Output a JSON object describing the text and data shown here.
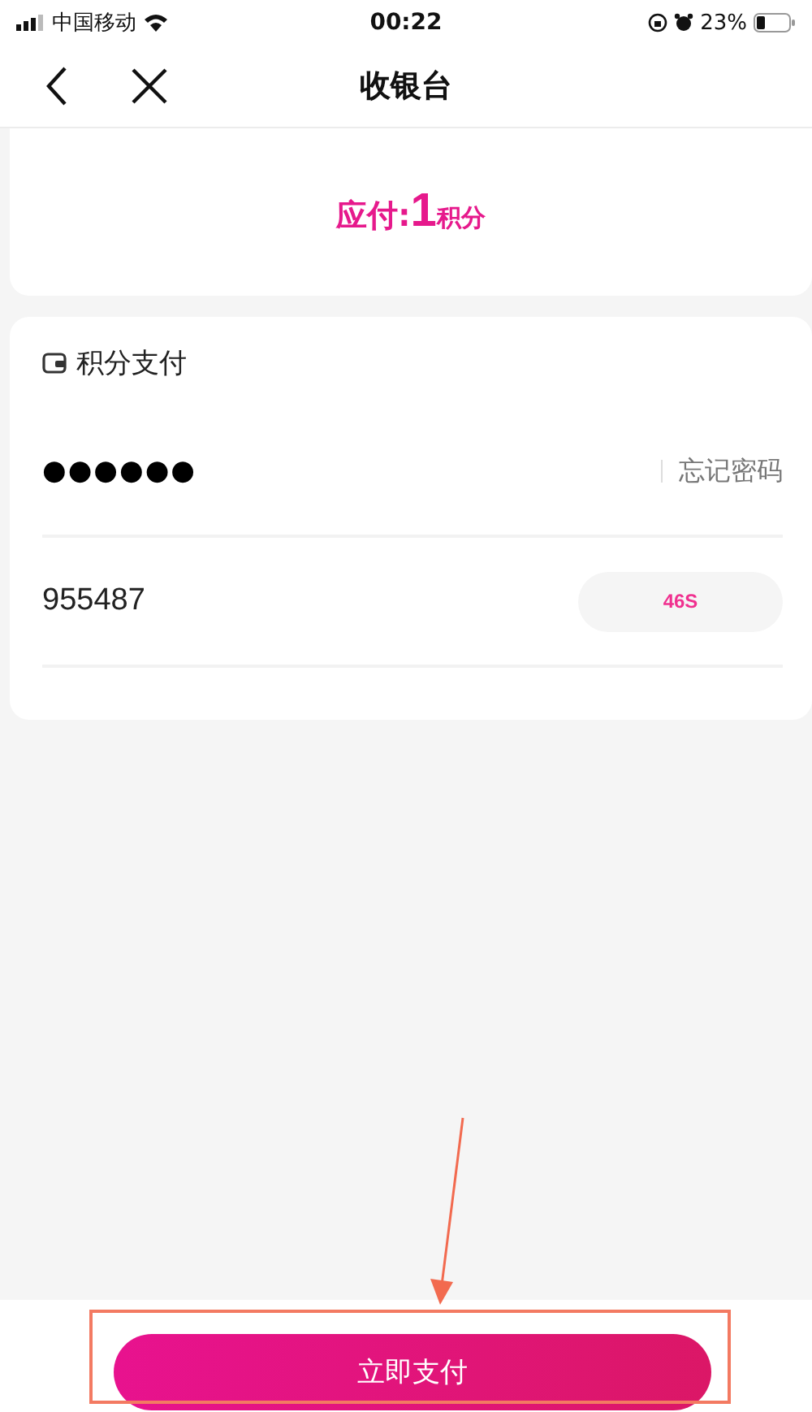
{
  "status_bar": {
    "carrier": "中国移动",
    "time": "00:22",
    "battery": "23%"
  },
  "nav": {
    "title": "收银台"
  },
  "amount": {
    "label": "应付:",
    "value": "1",
    "unit": "积分"
  },
  "payment": {
    "title": "积分支付",
    "password": "●●●●●●",
    "forgot_link": "忘记密码",
    "code": "955487",
    "countdown": "46S"
  },
  "footer": {
    "pay_button": "立即支付"
  }
}
